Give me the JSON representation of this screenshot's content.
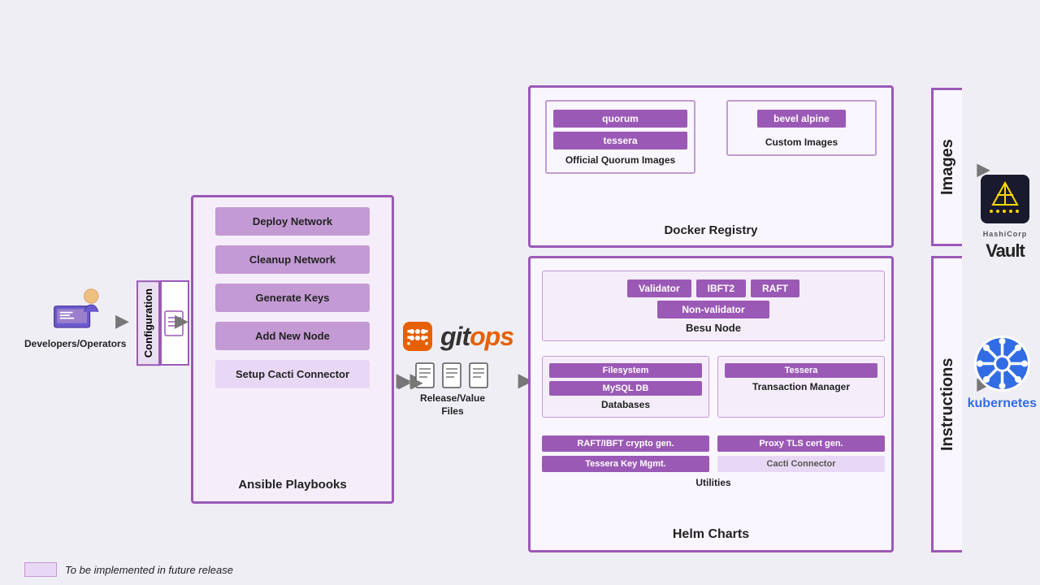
{
  "dev": {
    "label": "Developers/Operators"
  },
  "config": {
    "label": "Configuration"
  },
  "ansible": {
    "title": "Ansible Playbooks",
    "buttons": [
      {
        "label": "Deploy  Network",
        "id": "deploy-network",
        "future": false
      },
      {
        "label": "Cleanup Network",
        "id": "cleanup-network",
        "future": false
      },
      {
        "label": "Generate Keys",
        "id": "generate-keys",
        "future": false
      },
      {
        "label": "Add  New Node",
        "id": "add-new-node",
        "future": false
      },
      {
        "label": "Setup Cacti Connector",
        "id": "setup-cacti",
        "future": false
      }
    ]
  },
  "gitops": {
    "logo": "gitops"
  },
  "release_files": {
    "label1": "Release/Value",
    "label2": "Files"
  },
  "docker": {
    "title": "Docker Registry",
    "official": {
      "chips": [
        "quorum",
        "tessera"
      ],
      "label": "Official Quorum Images"
    },
    "custom": {
      "chips": [
        "bevel alpine"
      ],
      "label": "Custom Images"
    }
  },
  "helm": {
    "title": "Helm Charts",
    "besu": {
      "chips": [
        "Validator",
        "IBFT2",
        "RAFT"
      ],
      "chip_wide": "Non-validator",
      "title": "Besu Node"
    },
    "databases": {
      "chips": [
        "Filesystem",
        "MySQL DB"
      ],
      "label": "Databases"
    },
    "transaction": {
      "chips": [
        "Tessera"
      ],
      "label": "Transaction Manager"
    },
    "utilities": {
      "left_chips": [
        "RAFT/IBFT crypto gen.",
        "Tessera Key Mgmt."
      ],
      "right_chips": [
        "Proxy TLS cert gen.",
        "Cacti Connector"
      ],
      "label": "Utilities"
    }
  },
  "side_labels": {
    "images": "Images",
    "instructions": "Instructions"
  },
  "vault": {
    "sub": "HashiCorp",
    "label": "Vault"
  },
  "kubernetes": {
    "label": "kubernetes"
  },
  "legend": {
    "text": "To be implemented in future release"
  }
}
